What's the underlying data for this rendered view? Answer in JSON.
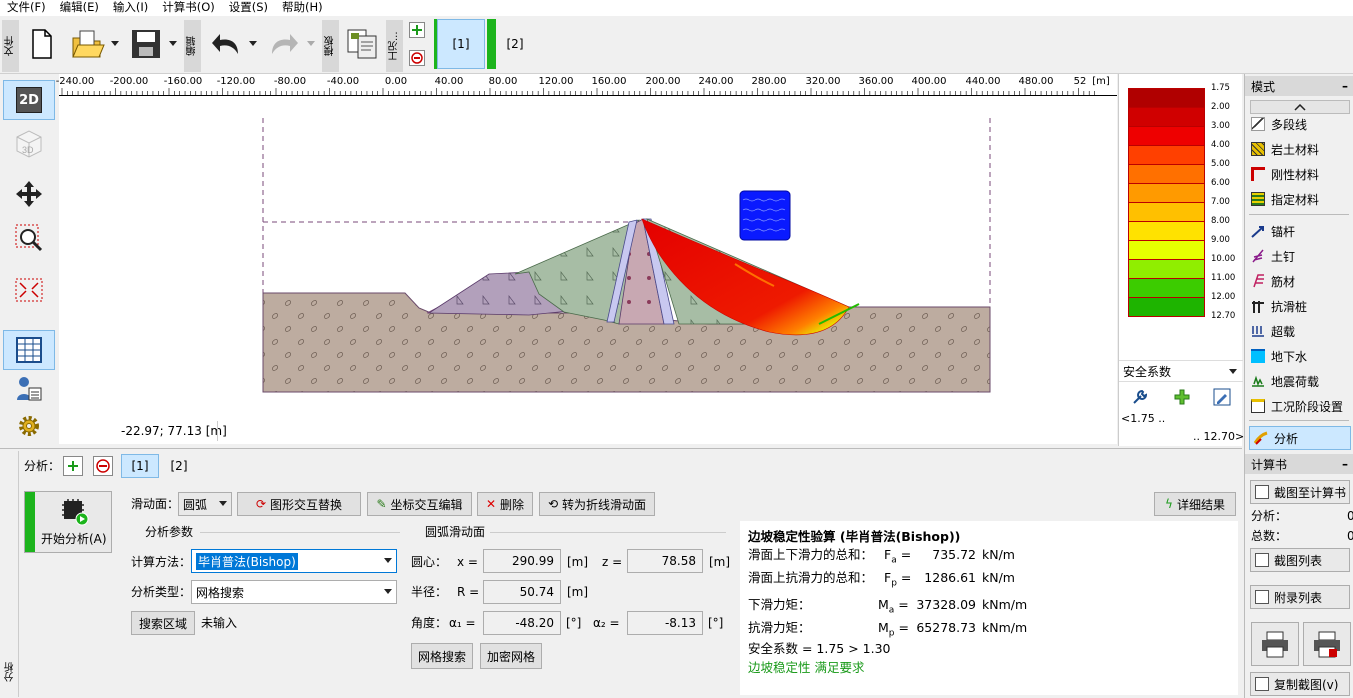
{
  "menu": [
    "文件(F)",
    "编辑(E)",
    "输入(I)",
    "计算书(O)",
    "设置(S)",
    "帮助(H)"
  ],
  "toolbar": {
    "file_label": "文件",
    "edit_label": "编辑",
    "template_label": "模板",
    "stage_label": "工况...",
    "stage1": "[1]",
    "stage2": "[2]"
  },
  "left_tools": [
    "2D",
    "3D"
  ],
  "ruler": {
    "unit": "[m]",
    "ticks": [
      "-240.00",
      "-200.00",
      "-160.00",
      "-120.00",
      "-80.00",
      "-40.00",
      "0.00",
      "40.00",
      "80.00",
      "120.00",
      "160.00",
      "200.00",
      "240.00",
      "280.00",
      "320.00",
      "360.00",
      "400.00",
      "440.00",
      "480.00",
      "52"
    ]
  },
  "coordinates": "-22.97; 77.13 [m]",
  "legend": {
    "values": [
      "1.75",
      "2.00",
      "3.00",
      "4.00",
      "5.00",
      "6.00",
      "7.00",
      "8.00",
      "9.00",
      "10.00",
      "11.00",
      "12.00",
      "12.70"
    ],
    "colors": [
      "#b00000",
      "#d00000",
      "#ee0000",
      "#ff4000",
      "#ff7000",
      "#ff9a00",
      "#ffc000",
      "#ffe200",
      "#e6ff00",
      "#90ee00",
      "#3ccc00",
      "#1eb400"
    ],
    "type_label": "安全系数",
    "min_label": "<1.75 ..",
    "max_label": ".. 12.70>"
  },
  "right_panel": {
    "mode_title": "模式",
    "items": [
      "多段线",
      "岩土材料",
      "刚性材料",
      "指定材料",
      "锚杆",
      "土钉",
      "筋材",
      "抗滑桩",
      "超载",
      "地下水",
      "地震荷载",
      "工况阶段设置",
      "分析"
    ],
    "report_title": "计算书",
    "capture_btn": "截图至计算书",
    "analysis_label": "分析：",
    "analysis_value": "0",
    "total_label": "总数：",
    "total_value": "0",
    "capture_list": "截图列表",
    "appendix_list": "附录列表",
    "copy_capture": "复制截图(v)"
  },
  "bottom": {
    "side_label": "分析",
    "analysis_label": "分析：",
    "tab1": "[1]",
    "tab2": "[2]",
    "start_btn": "开始分析(A)",
    "slip_label": "滑动面：",
    "slip_value": "圆弧",
    "btn_swap": "图形交互替换",
    "btn_coord": "坐标交互编辑",
    "btn_delete": "删除",
    "btn_polyline": "转为折线滑动面",
    "btn_details": "详细结果",
    "params_title": "分析参数",
    "arc_title": "圆弧滑动面",
    "method_label": "计算方法：",
    "method_value": "毕肖普法(Bishop)",
    "type_label": "分析类型：",
    "type_value": "网格搜索",
    "search_area_btn": "搜索区域",
    "not_input": "未输入",
    "center_label": "圆心：",
    "x_label": "x =",
    "x_value": "290.99",
    "z_label": "z =",
    "z_value": "78.58",
    "radius_label": "半径：",
    "r_label": "R =",
    "r_value": "50.74",
    "unit_m": "[m]",
    "angle_label": "角度：",
    "a1_label": "α₁ =",
    "a1_value": "-48.20",
    "a2_label": "α₂ =",
    "a2_value": "-8.13",
    "unit_deg": "[°]",
    "grid_search_btn": "网格搜索",
    "refine_btn": "加密网格"
  },
  "results": {
    "title": "边坡稳定性验算 (毕肖普法(Bishop))",
    "fa_label": "滑面上下滑力的总和：",
    "fa_sym": "F",
    "fa_sub": "a",
    "fa_value": "735.72",
    "fa_unit": "kN/m",
    "fp_label": "滑面上抗滑力的总和：",
    "fp_sym": "F",
    "fp_sub": "p",
    "fp_value": "1286.61",
    "fp_unit": "kN/m",
    "ma_label": "下滑力矩：",
    "ma_sym": "M",
    "ma_sub": "a",
    "ma_value": "37328.09",
    "ma_unit": "kNm/m",
    "mp_label": "抗滑力矩：",
    "mp_sym": "M",
    "mp_sub": "p",
    "mp_value": "65278.73",
    "mp_unit": "kNm/m",
    "fs_line": "安全系数 = 1.75 > 1.30",
    "verdict": "边坡稳定性 满足要求"
  }
}
